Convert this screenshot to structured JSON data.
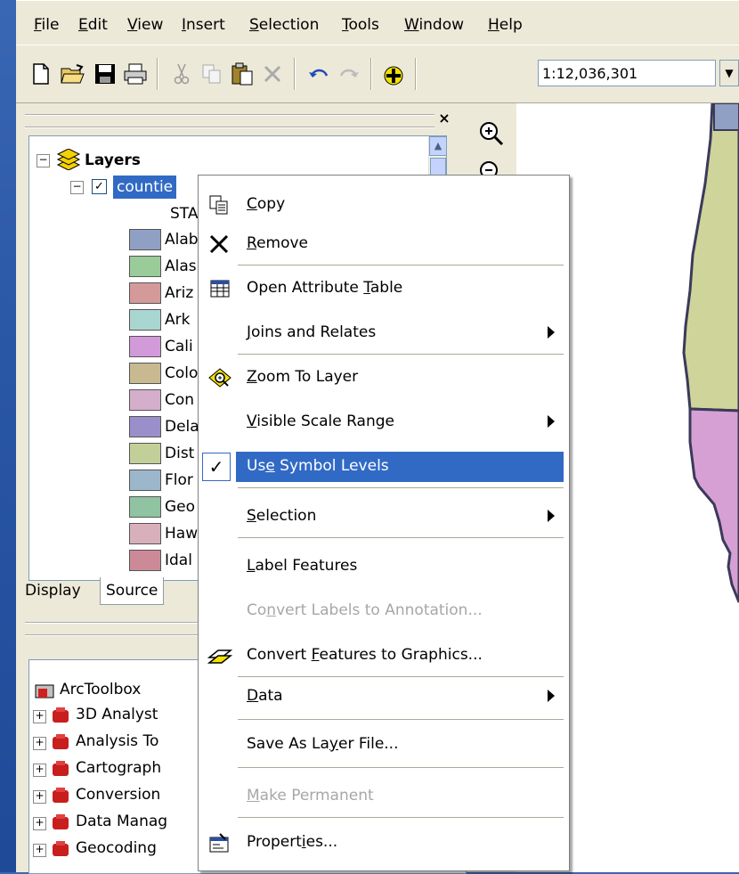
{
  "menu": [
    "File",
    "Edit",
    "View",
    "Insert",
    "Selection",
    "Tools",
    "Window",
    "Help"
  ],
  "menu_underline": [
    "F",
    "E",
    "V",
    "I",
    "S",
    "T",
    "W",
    "H"
  ],
  "toolbar": {
    "scale": "1:12,036,301"
  },
  "toc": {
    "root": "Layers",
    "layer": "countie",
    "field": "STA",
    "classes": [
      "Alab",
      "Alas",
      "Ariz",
      "Ark",
      "Cali",
      "Colo",
      "Con",
      "Dela",
      "Dist",
      "Flor",
      "Geo",
      "Haw",
      "Idal"
    ],
    "tabs": [
      "Display",
      "Source"
    ]
  },
  "toolbox": {
    "root": "ArcToolbox",
    "items": [
      "3D Analyst",
      "Analysis To",
      "Cartograph",
      "Conversion",
      "Data Manag",
      "Geocoding"
    ]
  },
  "context_menu": {
    "items": [
      {
        "pre": "",
        "u": "C",
        "post": "opy"
      },
      {
        "pre": "",
        "u": "R",
        "post": "emove"
      },
      {
        "pre": "Open Attribute ",
        "u": "T",
        "post": "able"
      },
      {
        "pre": "",
        "u": "J",
        "post": "oins and Relates"
      },
      {
        "pre": "",
        "u": "Z",
        "post": "oom To Layer"
      },
      {
        "pre": "",
        "u": "V",
        "post": "isible Scale Range"
      },
      {
        "pre": "Us",
        "u": "e",
        "post": " Symbol Levels"
      },
      {
        "pre": "",
        "u": "S",
        "post": "election"
      },
      {
        "pre": "",
        "u": "L",
        "post": "abel Features"
      },
      {
        "pre": "Co",
        "u": "n",
        "post": "vert Labels to Annotation..."
      },
      {
        "pre": "Convert ",
        "u": "F",
        "post": "eatures to Graphics..."
      },
      {
        "pre": "",
        "u": "D",
        "post": "ata"
      },
      {
        "pre": "Save As La",
        "u": "y",
        "post": "er File..."
      },
      {
        "pre": "",
        "u": "M",
        "post": "ake Permanent"
      },
      {
        "pre": "Propert",
        "u": "i",
        "post": "es..."
      }
    ]
  },
  "colors": {
    "swatches": [
      "#8fa0c4",
      "#99cc99",
      "#d49a9a",
      "#a9d6d0",
      "#d29ad8",
      "#c9b991",
      "#d5aecb",
      "#9a8fca",
      "#c3cf99",
      "#9cb6cc",
      "#8fc3a1",
      "#d8b0bb",
      "#cc8a99"
    ],
    "selection": "#316ac5",
    "map_state_1": "#cfd49a",
    "map_state_2": "#d7a0d4"
  }
}
